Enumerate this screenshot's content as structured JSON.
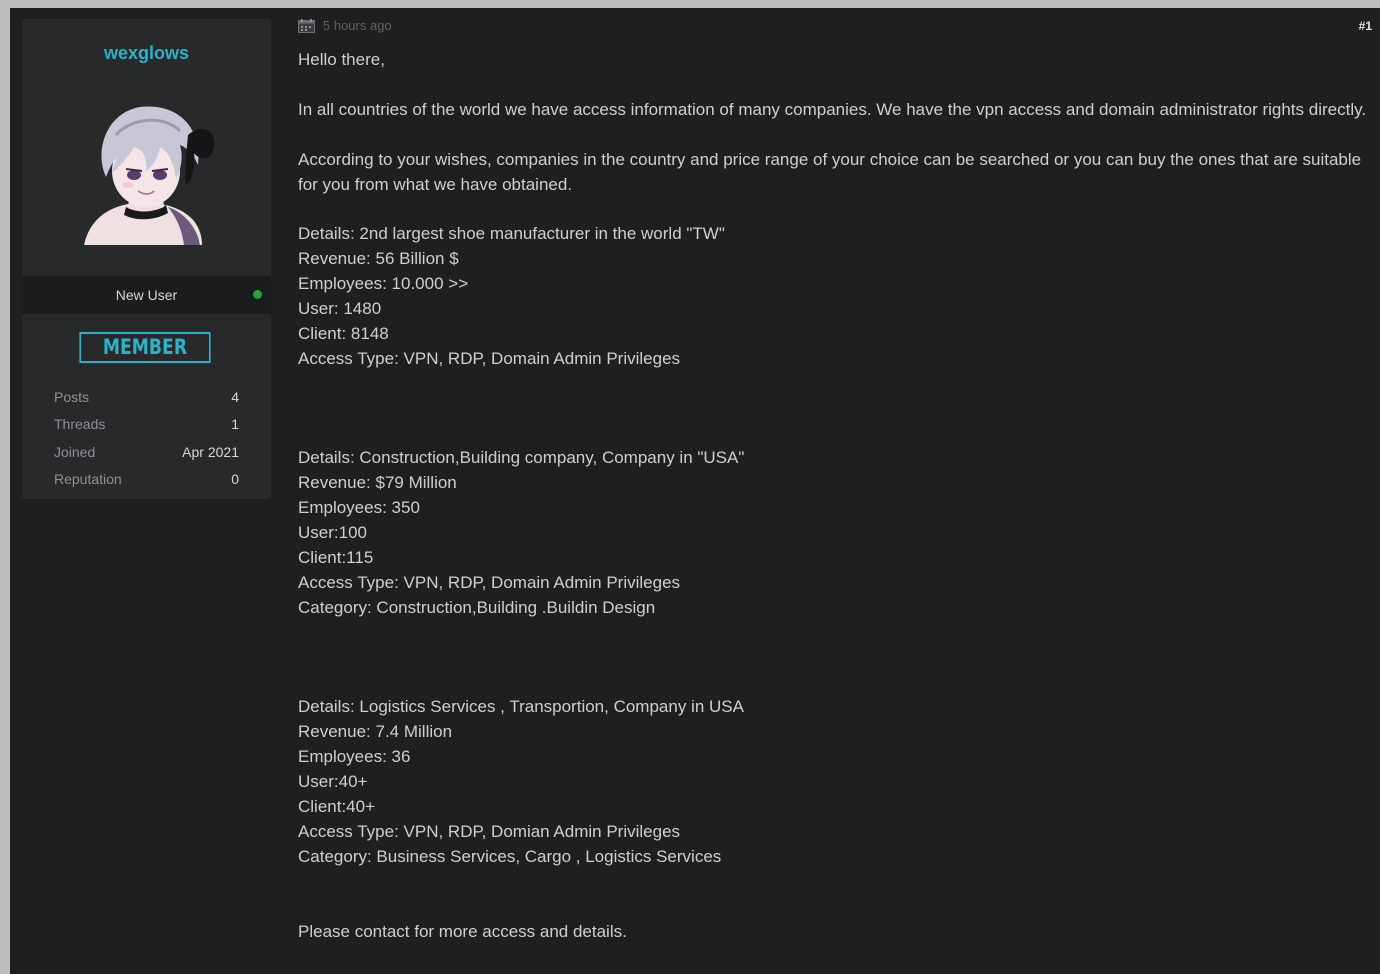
{
  "user": {
    "username": "wexglows",
    "title": "New User",
    "online_status": "online",
    "badge": "MEMBER",
    "stats": [
      {
        "label": "Posts",
        "value": "4"
      },
      {
        "label": "Threads",
        "value": "1"
      },
      {
        "label": "Joined",
        "value": "Apr 2021"
      },
      {
        "label": "Reputation",
        "value": "0"
      }
    ]
  },
  "post": {
    "date": "5 hours ago",
    "number": "#1",
    "greeting": "Hello there,",
    "intro": "In all countries of the world we have access information of many companies. We have the vpn access and domain administrator rights directly.",
    "offer": "According to your wishes, companies in the country and price range of your choice can be searched or you can buy the ones that are suitable for you from what we have obtained.",
    "listing1": [
      "Details: 2nd largest shoe manufacturer in the world \"TW\"",
      "Revenue: 56 Billion $",
      "Employees: 10.000 >>",
      "User: 1480",
      "Client: 8148",
      "Access Type: VPN, RDP, Domain Admin Privileges"
    ],
    "listing2": [
      "Details: Construction,Building company, Company in \"USA\"",
      "Revenue: $79 Million",
      "Employees: 350",
      "User:100",
      "Client:115",
      "Access Type: VPN, RDP, Domain Admin Privileges",
      "Category: Construction,Building .Buildin Design"
    ],
    "listing3": [
      "Details: Logistics Services , Transportion, Company in USA",
      "Revenue: 7.4 Million",
      "Employees: 36",
      "User:40+",
      "Client:40+",
      "Access Type: VPN, RDP, Domian Admin Privileges",
      "Category: Business Services, Cargo , Logistics Services"
    ],
    "closing": "Please contact for more access and details."
  },
  "colors": {
    "accent": "#2bb3c8",
    "online": "#27a33a",
    "background": "#1f1f20",
    "panel": "#27292b"
  }
}
